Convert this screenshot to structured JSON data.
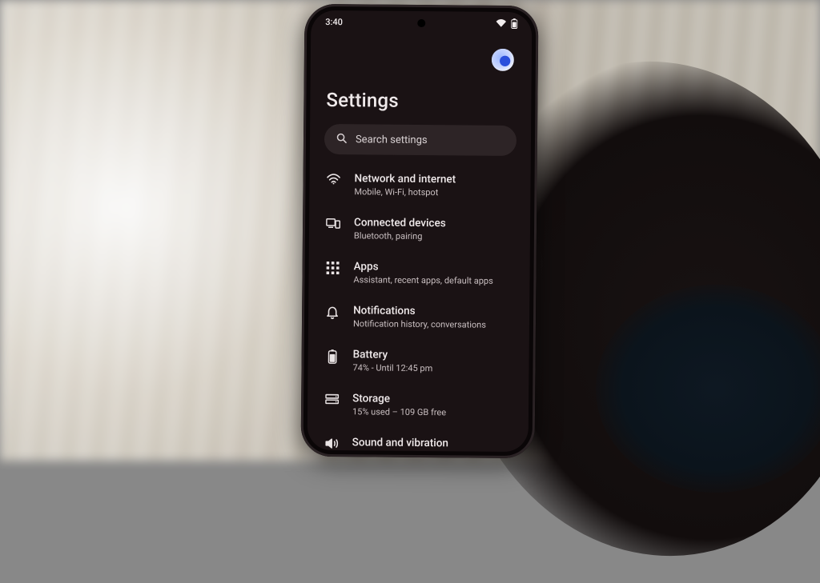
{
  "statusbar": {
    "time": "3:40"
  },
  "header": {
    "title": "Settings"
  },
  "search": {
    "placeholder": "Search settings"
  },
  "items": [
    {
      "id": "network",
      "title": "Network and internet",
      "sub": "Mobile, Wi-Fi, hotspot"
    },
    {
      "id": "connected",
      "title": "Connected devices",
      "sub": "Bluetooth, pairing"
    },
    {
      "id": "apps",
      "title": "Apps",
      "sub": "Assistant, recent apps, default apps"
    },
    {
      "id": "notifications",
      "title": "Notifications",
      "sub": "Notification history, conversations"
    },
    {
      "id": "battery",
      "title": "Battery",
      "sub": "74% - Until 12:45 pm"
    },
    {
      "id": "storage",
      "title": "Storage",
      "sub": "15% used – 109 GB free"
    },
    {
      "id": "sound",
      "title": "Sound and vibration",
      "sub": ""
    }
  ]
}
